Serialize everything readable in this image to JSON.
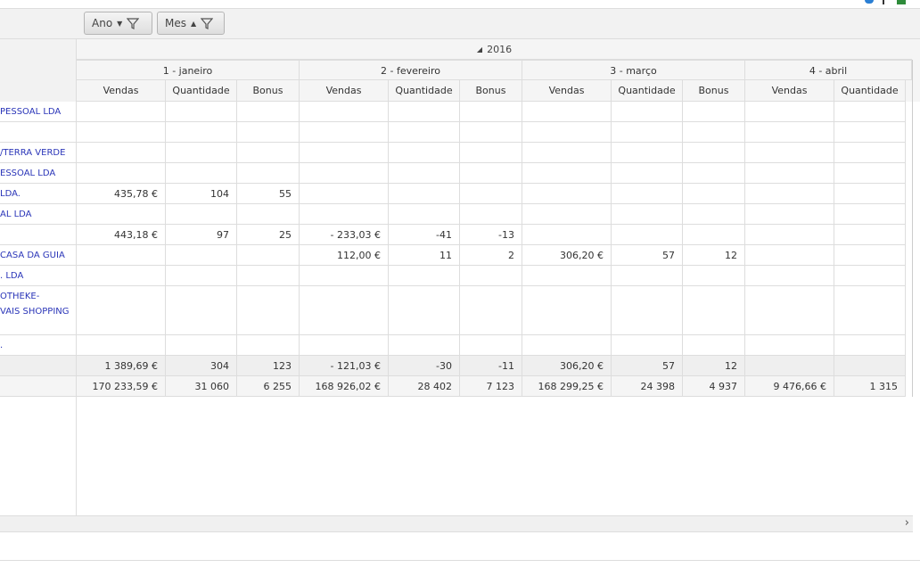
{
  "filters": {
    "ano": "Ano",
    "mes": "Mes"
  },
  "year": "2016",
  "months": [
    "1 - janeiro",
    "2 - fevereiro",
    "3 - março",
    "4 - abril"
  ],
  "measures": [
    "Vendas",
    "Quantidade",
    "Bonus"
  ],
  "rows": [
    {
      "label": "PESSOAL LDA",
      "values": [
        "",
        "",
        "",
        "",
        "",
        "",
        "",
        "",
        "",
        "",
        ""
      ]
    },
    {
      "label": "",
      "values": [
        "",
        "",
        "",
        "",
        "",
        "",
        "",
        "",
        "",
        "",
        ""
      ]
    },
    {
      "label": "/TERRA VERDE",
      "values": [
        "",
        "",
        "",
        "",
        "",
        "",
        "",
        "",
        "",
        "",
        ""
      ]
    },
    {
      "label": "ESSOAL LDA",
      "values": [
        "",
        "",
        "",
        "",
        "",
        "",
        "",
        "",
        "",
        "",
        ""
      ]
    },
    {
      "label": " LDA.",
      "values": [
        "435,78 €",
        "104",
        "55",
        "",
        "",
        "",
        "",
        "",
        "",
        "",
        ""
      ]
    },
    {
      "label": "AL LDA",
      "values": [
        "",
        "",
        "",
        "",
        "",
        "",
        "",
        "",
        "",
        "",
        ""
      ]
    },
    {
      "label": "",
      "values": [
        "443,18 €",
        "97",
        "25",
        "- 233,03 €",
        "-41",
        "-13",
        "",
        "",
        "",
        "",
        ""
      ]
    },
    {
      "label": "CASA DA GUIA",
      "values": [
        "",
        "",
        "",
        "112,00 €",
        "11",
        "2",
        "306,20 €",
        "57",
        "12",
        "",
        ""
      ]
    },
    {
      "label": ". LDA",
      "values": [
        "",
        "",
        "",
        "",
        "",
        "",
        "",
        "",
        "",
        "",
        ""
      ]
    },
    {
      "label": "OTHEKE-",
      "label2": "VAIS SHOPPING",
      "values": [
        "",
        "",
        "",
        "",
        "",
        "",
        "",
        "",
        "",
        "",
        ""
      ]
    },
    {
      "label": ".",
      "values": [
        "",
        "",
        "",
        "",
        "",
        "",
        "",
        "",
        "",
        "",
        ""
      ]
    }
  ],
  "subtotal": [
    "1 389,69 €",
    "304",
    "123",
    "- 121,03 €",
    "-30",
    "-11",
    "306,20 €",
    "57",
    "12",
    "",
    ""
  ],
  "grandtotal": [
    "170 233,59 €",
    "31 060",
    "6 255",
    "168 926,02 €",
    "28 402",
    "7 123",
    "168 299,25 €",
    "24 398",
    "4 937",
    "9 476,66 €",
    "1 315"
  ],
  "scroll_right_icon": "chevron-right-icon"
}
